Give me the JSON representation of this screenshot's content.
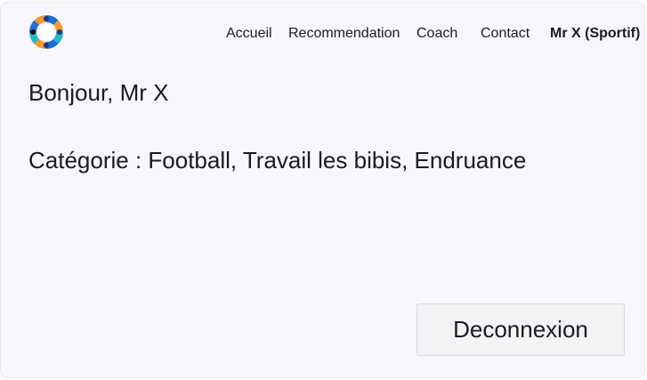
{
  "header": {
    "logo_icon": "circular-team-logo-icon",
    "nav": {
      "accueil": "Accueil",
      "recommendation": "Recommendation",
      "coach": "Coach",
      "contact": "Contact",
      "user": "Mr X (Sportif)"
    }
  },
  "main": {
    "greeting": "Bonjour, Mr X",
    "category": "Catégorie : Football, Travail les bibis, Endruance"
  },
  "actions": {
    "logout_label": "Deconnexion"
  },
  "colors": {
    "background": "#f8f6fd",
    "text": "#1b1b1f",
    "button_bg": "#f3f2f4",
    "logo_blue": "#1d6fd6",
    "logo_orange": "#f29a2e",
    "logo_teal": "#2bb5c9"
  }
}
